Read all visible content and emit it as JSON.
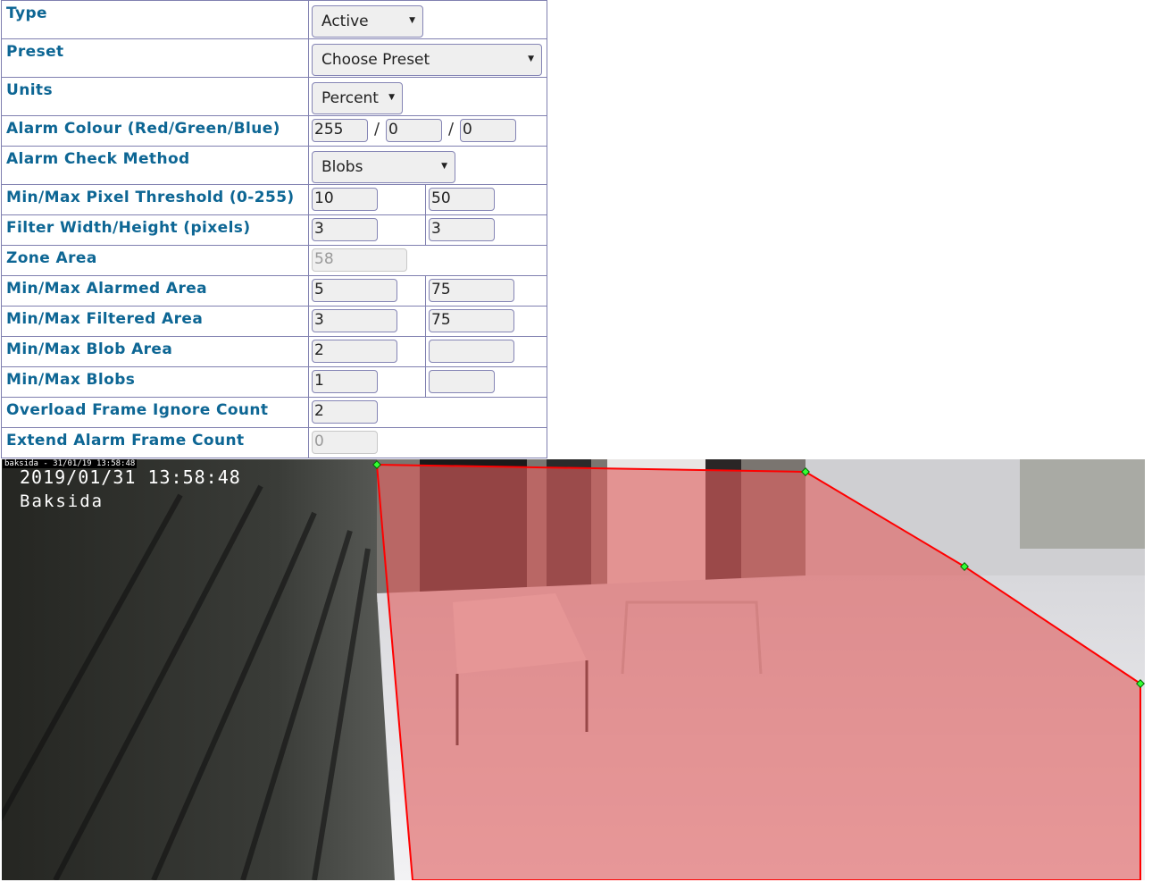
{
  "form": {
    "type": {
      "label": "Type",
      "value": "Active"
    },
    "preset": {
      "label": "Preset",
      "value": "Choose Preset"
    },
    "units": {
      "label": "Units",
      "value": "Percent"
    },
    "alarm_colour": {
      "label": "Alarm Colour (Red/Green/Blue)",
      "red": "255",
      "green": "0",
      "blue": "0",
      "separator": "/"
    },
    "check_method": {
      "label": "Alarm Check Method",
      "value": "Blobs"
    },
    "pixel_threshold": {
      "label": "Min/Max Pixel Threshold (0-255)",
      "min": "10",
      "max": "50"
    },
    "filter_size": {
      "label": "Filter Width/Height (pixels)",
      "width": "3",
      "height": "3"
    },
    "zone_area": {
      "label": "Zone Area",
      "value": "58"
    },
    "alarmed_area": {
      "label": "Min/Max Alarmed Area",
      "min": "5",
      "max": "75"
    },
    "filtered_area": {
      "label": "Min/Max Filtered Area",
      "min": "3",
      "max": "75"
    },
    "blob_area": {
      "label": "Min/Max Blob Area",
      "min": "2",
      "max": ""
    },
    "blobs": {
      "label": "Min/Max Blobs",
      "min": "1",
      "max": ""
    },
    "overload_ignore": {
      "label": "Overload Frame Ignore Count",
      "value": "2"
    },
    "extend_alarm": {
      "label": "Extend Alarm Frame Count",
      "value": "0"
    }
  },
  "camera": {
    "overlay_small": "baksida - 31/01/19 13:58:48",
    "timestamp": "2019/01/31 13:58:48",
    "name": "Baksida"
  },
  "zone_overlay": {
    "fill_color": "#e06060",
    "line_color": "#ff0000",
    "handle_color": "#33ff33"
  }
}
